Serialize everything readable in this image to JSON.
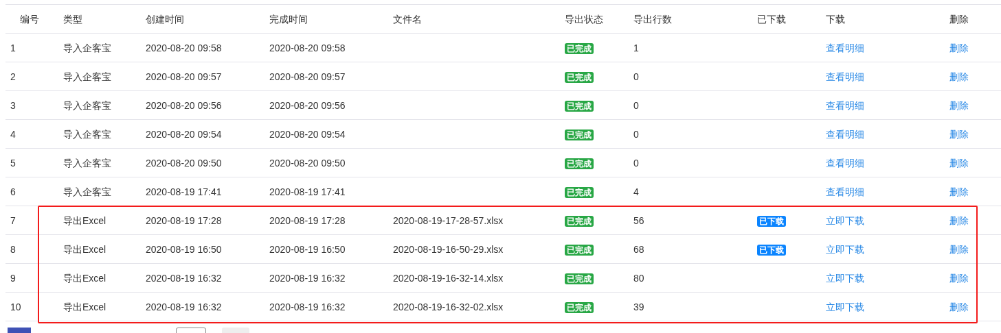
{
  "table": {
    "columns": [
      "编号",
      "类型",
      "创建时间",
      "完成时间",
      "文件名",
      "导出状态",
      "导出行数",
      "已下载",
      "下载",
      "删除"
    ],
    "rows": [
      {
        "id": "1",
        "type": "导入企客宝",
        "created": "2020-08-20 09:58",
        "finished": "2020-08-20 09:58",
        "status": "已完成",
        "row_count": "1",
        "action": "查看明细",
        "delete": "删除",
        "highlighted": false
      },
      {
        "id": "2",
        "type": "导入企客宝",
        "created": "2020-08-20 09:57",
        "finished": "2020-08-20 09:57",
        "status": "已完成",
        "row_count": "0",
        "action": "查看明细",
        "delete": "删除",
        "highlighted": false
      },
      {
        "id": "3",
        "type": "导入企客宝",
        "created": "2020-08-20 09:56",
        "finished": "2020-08-20 09:56",
        "status": "已完成",
        "row_count": "0",
        "action": "查看明细",
        "delete": "删除",
        "highlighted": false
      },
      {
        "id": "4",
        "type": "导入企客宝",
        "created": "2020-08-20 09:54",
        "finished": "2020-08-20 09:54",
        "status": "已完成",
        "row_count": "0",
        "action": "查看明细",
        "delete": "删除",
        "highlighted": false
      },
      {
        "id": "5",
        "type": "导入企客宝",
        "created": "2020-08-20 09:50",
        "finished": "2020-08-20 09:50",
        "status": "已完成",
        "row_count": "0",
        "action": "查看明细",
        "delete": "删除",
        "highlighted": false
      },
      {
        "id": "6",
        "type": "导入企客宝",
        "created": "2020-08-19 17:41",
        "finished": "2020-08-19 17:41",
        "status": "已完成",
        "row_count": "4",
        "action": "查看明细",
        "delete": "删除",
        "highlighted": false
      },
      {
        "id": "7",
        "type": "导出Excel",
        "created": "2020-08-19 17:28",
        "finished": "2020-08-19 17:28",
        "filename": "2020-08-19-17-28-57.xlsx",
        "status": "已完成",
        "row_count": "56",
        "downloaded": "已下载",
        "action": "立即下载",
        "delete": "删除",
        "highlighted": true
      },
      {
        "id": "8",
        "type": "导出Excel",
        "created": "2020-08-19 16:50",
        "finished": "2020-08-19 16:50",
        "filename": "2020-08-19-16-50-29.xlsx",
        "status": "已完成",
        "row_count": "68",
        "downloaded": "已下载",
        "action": "立即下载",
        "delete": "删除",
        "highlighted": true
      },
      {
        "id": "9",
        "type": "导出Excel",
        "created": "2020-08-19 16:32",
        "finished": "2020-08-19 16:32",
        "filename": "2020-08-19-16-32-14.xlsx",
        "status": "已完成",
        "row_count": "80",
        "action": "立即下载",
        "delete": "删除",
        "highlighted": true
      },
      {
        "id": "10",
        "type": "导出Excel",
        "created": "2020-08-19 16:32",
        "finished": "2020-08-19 16:32",
        "filename": "2020-08-19-16-32-02.xlsx",
        "status": "已完成",
        "row_count": "39",
        "action": "立即下载",
        "delete": "删除",
        "highlighted": true
      }
    ]
  }
}
